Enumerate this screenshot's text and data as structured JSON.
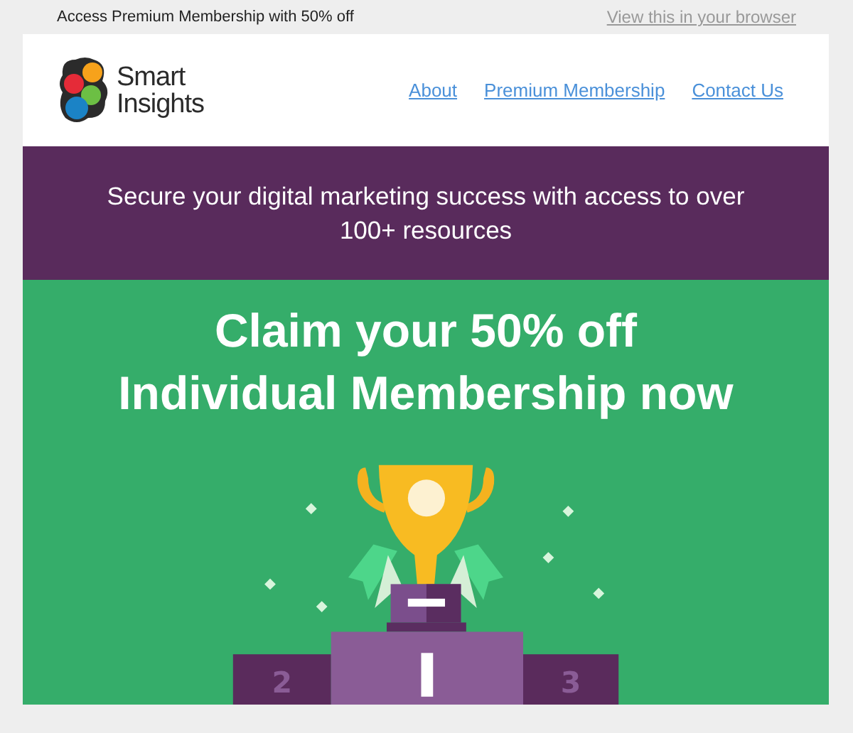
{
  "preheader": {
    "text": "Access Premium Membership with 50% off",
    "browser_link": "View this in your browser"
  },
  "logo": {
    "line_1": "Smart",
    "line_2": "Insights"
  },
  "nav": [
    {
      "label": "About"
    },
    {
      "label": "Premium Membership"
    },
    {
      "label": "Contact Us"
    }
  ],
  "banner": {
    "text": "Secure your digital marketing success with access to over 100+ resources"
  },
  "hero": {
    "headline_1": "Claim your 50% off",
    "headline_2": "Individual Membership now",
    "podium_labels": [
      "2",
      "3"
    ]
  }
}
